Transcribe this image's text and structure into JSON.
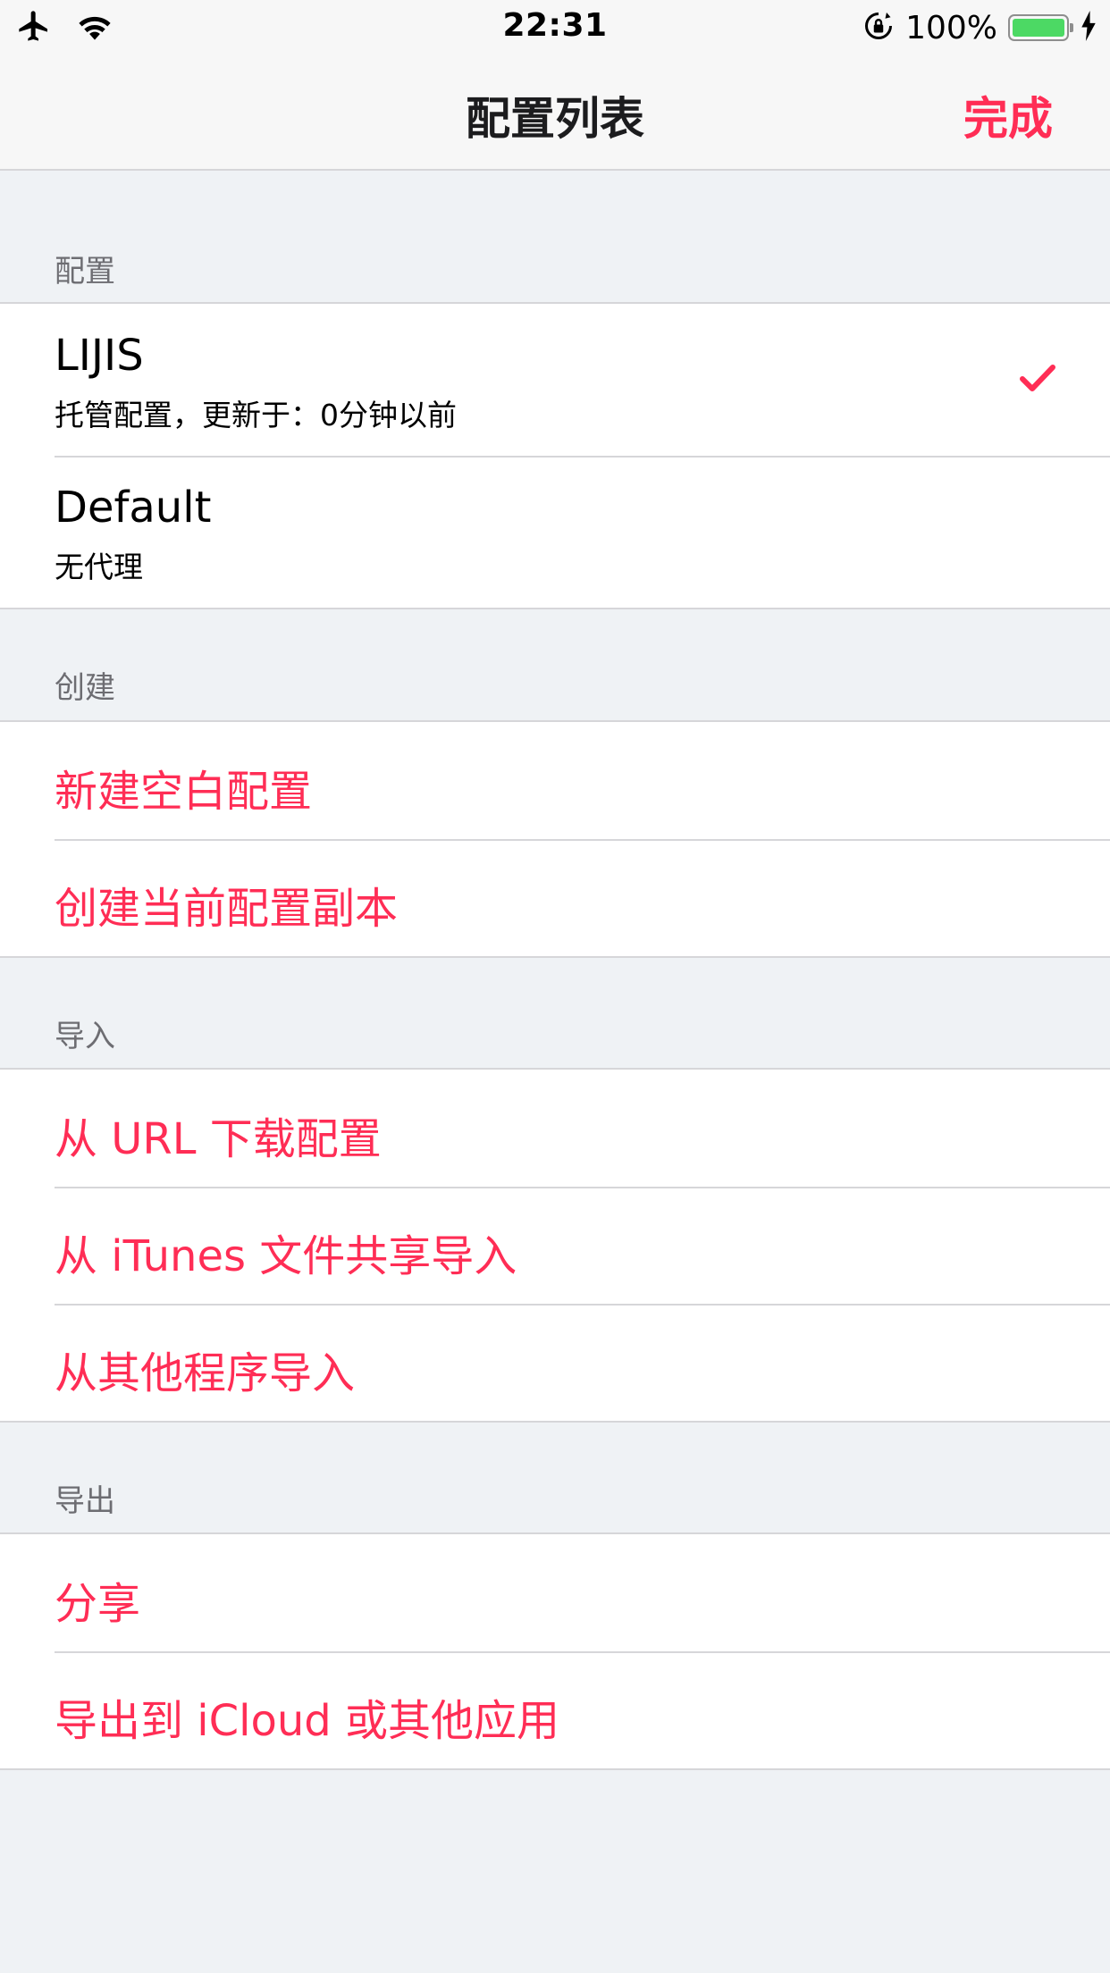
{
  "status_bar": {
    "time": "22:31",
    "battery_percent": "100%",
    "battery_level": 1.0,
    "icons": [
      "airplane-icon",
      "wifi-icon",
      "orientation-lock-icon",
      "battery-icon",
      "charging-bolt-icon"
    ]
  },
  "nav": {
    "title": "配置列表",
    "done_label": "完成"
  },
  "colors": {
    "accent": "#ff2d55",
    "background": "#eff2f5",
    "separator": "#d6d6d9",
    "battery": "#4cd964"
  },
  "sections": {
    "configs": {
      "header": "配置",
      "items": [
        {
          "title": "LIJIS",
          "subtitle": "托管配置，更新于：0分钟以前",
          "selected": true
        },
        {
          "title": "Default",
          "subtitle": "无代理",
          "selected": false
        }
      ]
    },
    "create": {
      "header": "创建",
      "items": [
        {
          "label": "新建空白配置"
        },
        {
          "label": "创建当前配置副本"
        }
      ]
    },
    "import": {
      "header": "导入",
      "items": [
        {
          "label": "从 URL 下载配置"
        },
        {
          "label": "从 iTunes 文件共享导入"
        },
        {
          "label": "从其他程序导入"
        }
      ]
    },
    "export": {
      "header": "导出",
      "items": [
        {
          "label": "分享"
        },
        {
          "label": "导出到 iCloud 或其他应用"
        }
      ]
    }
  }
}
